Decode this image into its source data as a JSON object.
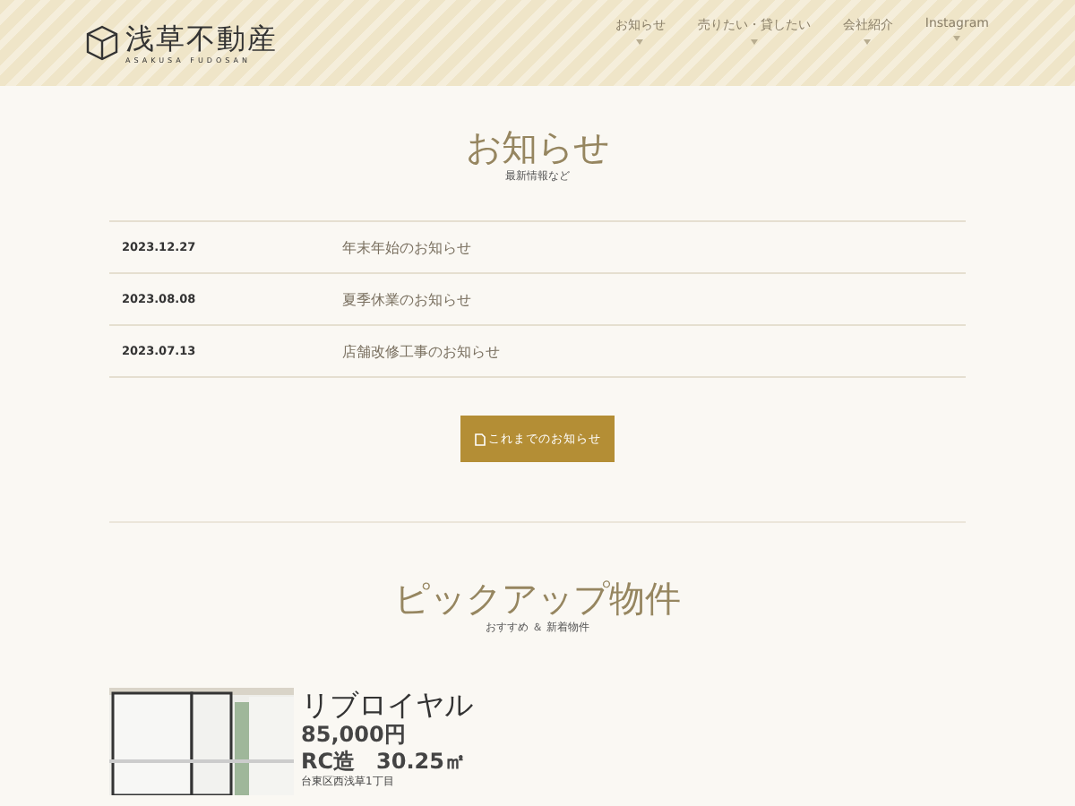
{
  "header": {
    "logo": "浅草不動産",
    "logo_sub": "ASAKUSA FUDOSAN",
    "nav": [
      {
        "label": "お知らせ"
      },
      {
        "label": "売りたい・貸したい"
      },
      {
        "label": "会社紹介"
      },
      {
        "label": "Instagram"
      }
    ]
  },
  "news": {
    "title": "お知らせ",
    "subtitle": "最新情報など",
    "items": [
      {
        "date": "2023.12.27",
        "title": "年末年始のお知らせ"
      },
      {
        "date": "2023.08.08",
        "title": "夏季休業のお知らせ"
      },
      {
        "date": "2023.07.13",
        "title": "店舗改修工事のお知らせ"
      }
    ],
    "more_button": "これまでのお知らせ"
  },
  "pickup": {
    "title": "ピックアップ物件",
    "subtitle": "おすすめ ＆ 新着物件",
    "properties": [
      {
        "name": "リブロイヤル",
        "price": "85,000円",
        "spec": "RC造　30.25㎡",
        "address": "台東区西浅草1丁目"
      }
    ]
  }
}
